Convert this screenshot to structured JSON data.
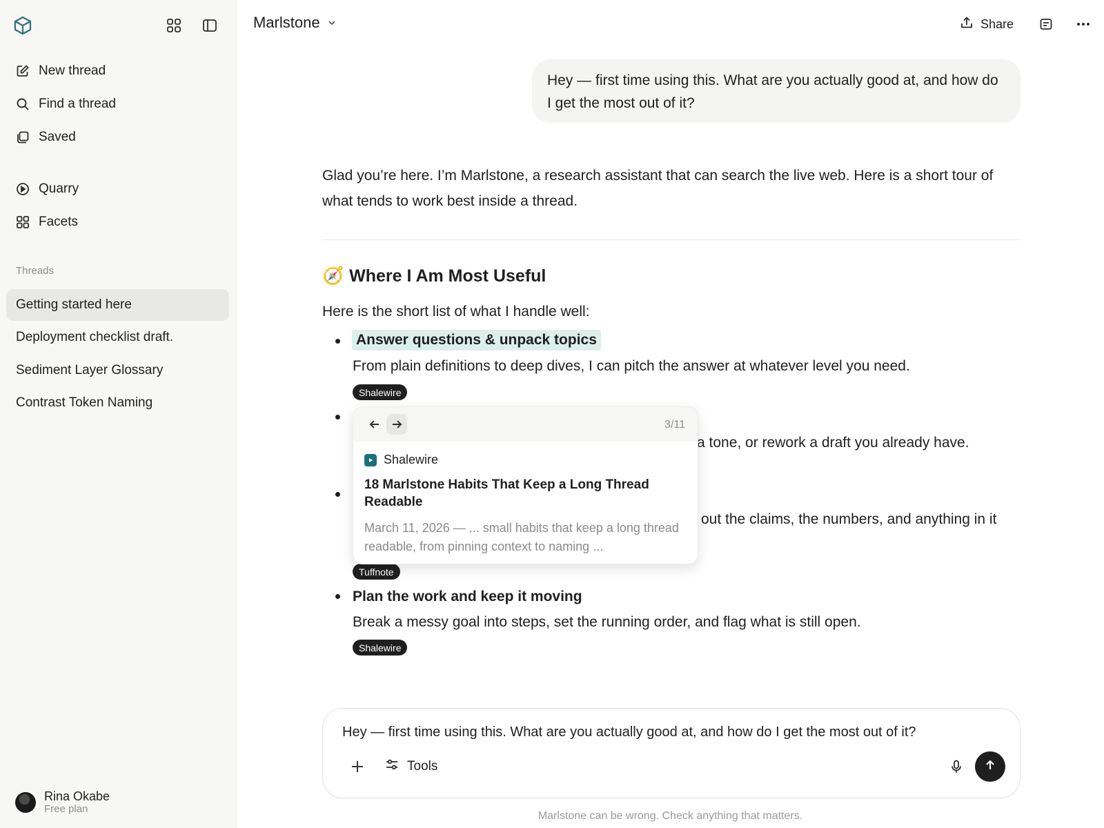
{
  "sidebar": {
    "nav": [
      {
        "label": "New thread",
        "icon": "compose-icon"
      },
      {
        "label": "Find a thread",
        "icon": "search-icon"
      },
      {
        "label": "Saved",
        "icon": "bookmark-stack-icon"
      }
    ],
    "secondary": [
      {
        "label": "Quarry",
        "icon": "play-circle-icon"
      },
      {
        "label": "Facets",
        "icon": "grid-icon"
      }
    ],
    "threads_header": "Threads",
    "threads": [
      {
        "label": "Getting started here",
        "active": true
      },
      {
        "label": "Deployment checklist draft.",
        "active": false
      },
      {
        "label": "Sediment Layer Glossary",
        "active": false
      },
      {
        "label": "Contrast Token Naming",
        "active": false
      }
    ],
    "user": {
      "name": "Rina Okabe",
      "plan": "Free plan"
    }
  },
  "header": {
    "title": "Marlstone",
    "share_label": "Share"
  },
  "conversation": {
    "user_message": "Hey — first time using this. What are you actually good at, and how do I get the most out of it?",
    "answer_intro": "Glad you’re here. I’m Marlstone, a research assistant that can search the live web. Here is a short tour of what tends to work best inside a thread.",
    "section_emoji": "🧭",
    "section_title": "Where I Am Most Useful",
    "section_lead": "Here is the short list of what I handle well:",
    "items": [
      {
        "title": "Answer questions & unpack topics",
        "desc": "From plain definitions to deep dives, I can pitch the answer at whatever level you need.",
        "source": "Shalewire"
      },
      {
        "title": "",
        "desc_visible": "a tone, or rework a draft you already have.",
        "source": ""
      },
      {
        "title": "",
        "desc_visible": "out the claims, the numbers, and anything in it",
        "source": "Tuffnote"
      },
      {
        "title": "Plan the work and keep it moving",
        "desc": "Break a messy goal into steps, set the running order, and flag what is still open.",
        "source": "Shalewire"
      }
    ]
  },
  "popover": {
    "count": "3/11",
    "source": "Shalewire",
    "title": "18 Marlstone Habits That Keep a Long Thread Readable",
    "snippet": "March 11, 2026 — ... small habits that keep a long thread readable, from pinning context to naming ..."
  },
  "composer": {
    "text": "Hey — first time using this. What are you actually good at, and how do I get the most out of it?",
    "tools_label": "Tools",
    "disclaimer": "Marlstone can be wrong. Check anything that matters."
  },
  "colors": {
    "highlight": "#dcefeb",
    "brand_icon": "#1d6f7a",
    "sidebar_bg": "#f7f7f6",
    "active_thread": "#e8e8e6"
  }
}
